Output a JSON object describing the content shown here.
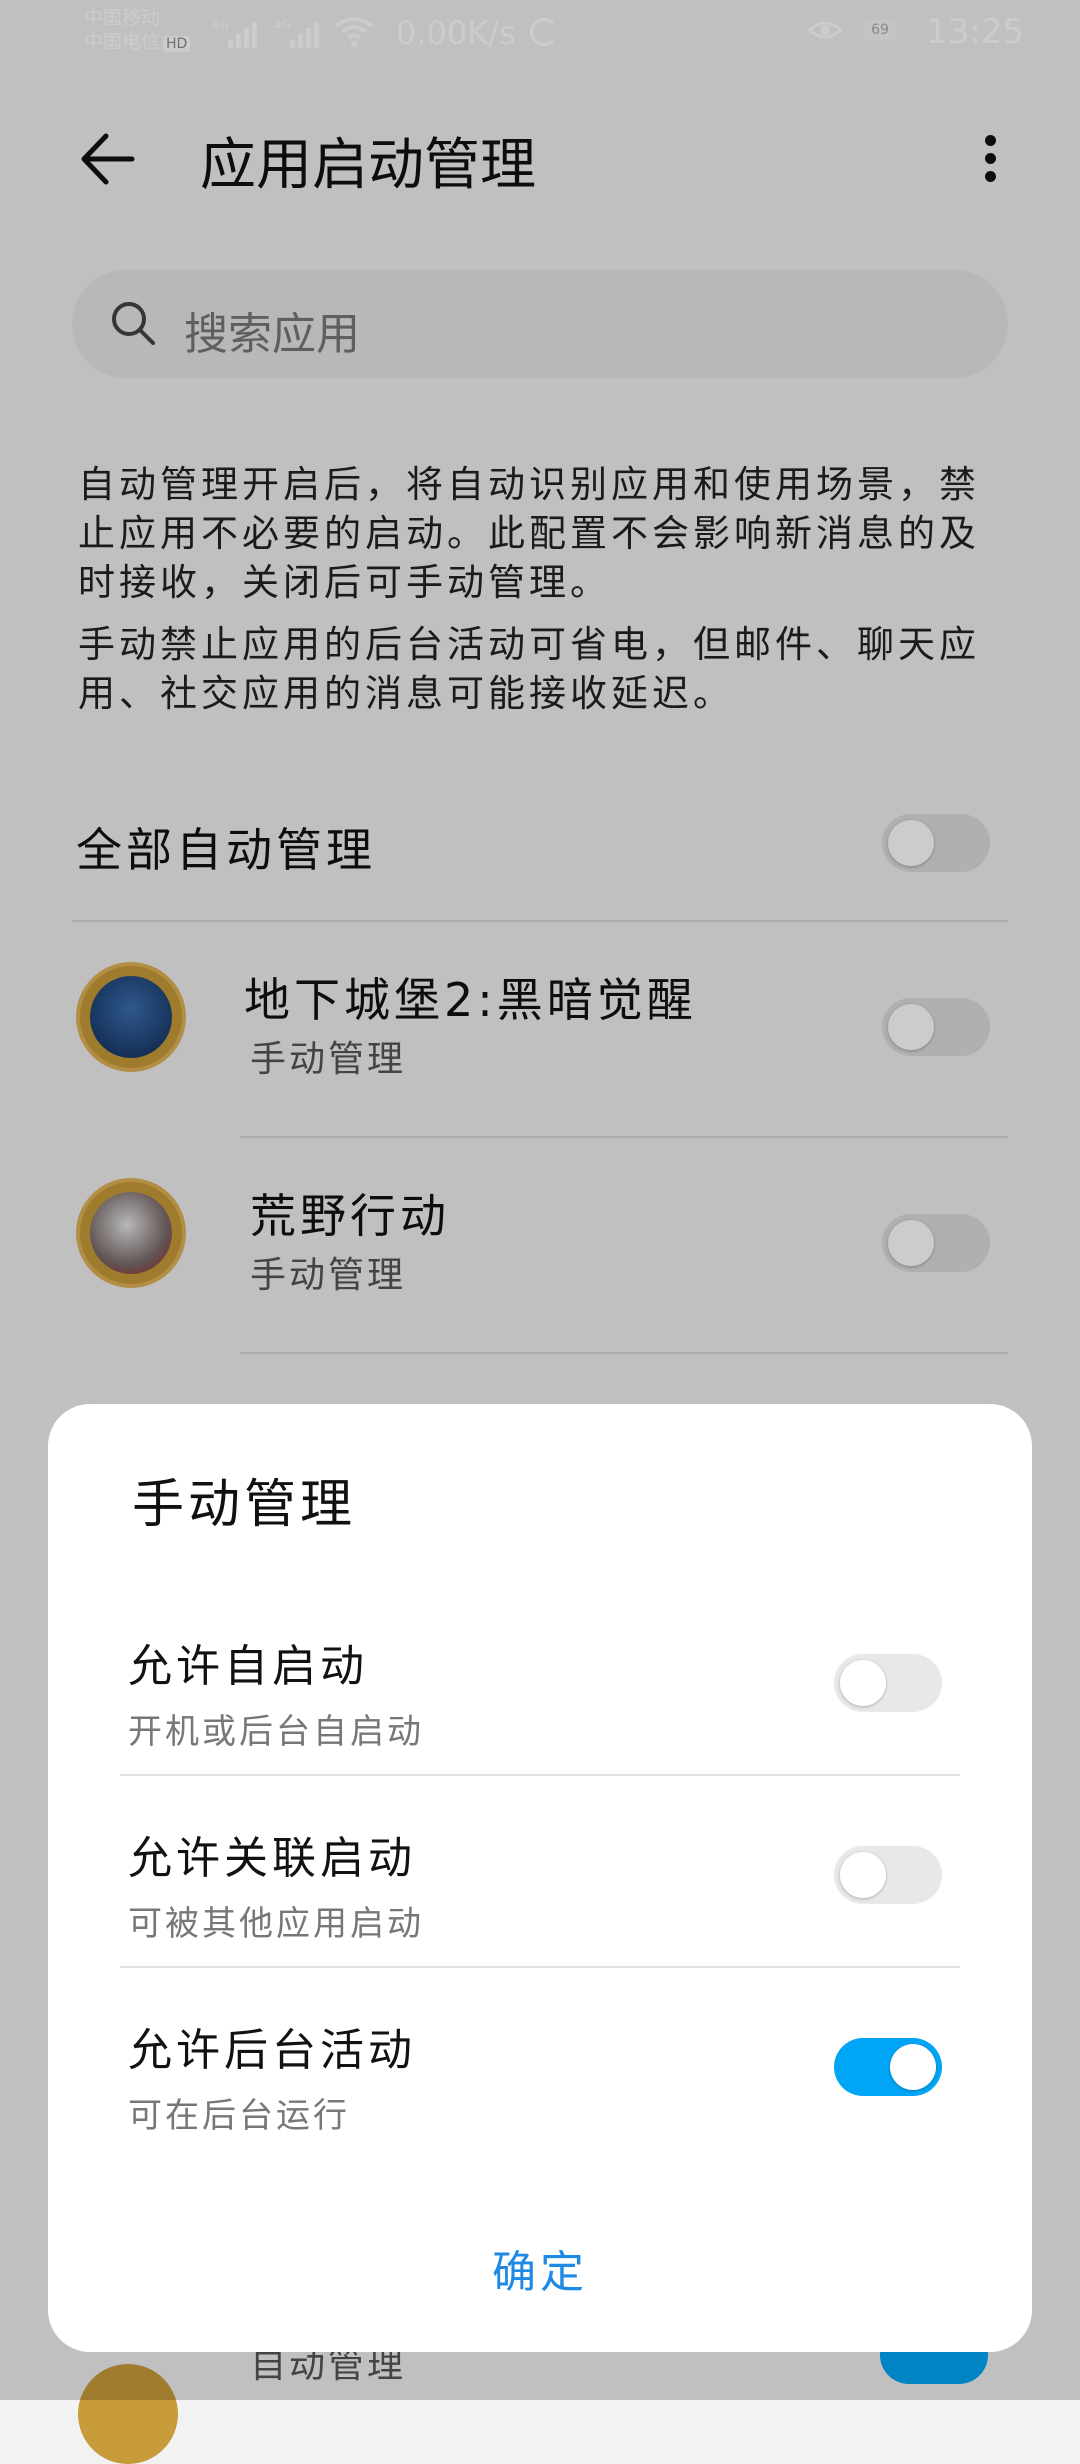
{
  "status_bar": {
    "carrier1": "中国移动",
    "carrier2": "中国电信",
    "hd": "HD",
    "sig1": "4G",
    "sig2": "4G",
    "speed": "0.00K/s",
    "battery": "69",
    "time": "13:25"
  },
  "header": {
    "title": "应用启动管理"
  },
  "search": {
    "placeholder": "搜索应用"
  },
  "description": {
    "para1": "自动管理开启后，将自动识别应用和使用场景，禁止应用不必要的启动。此配置不会影响新消息的及时接收，关闭后可手动管理。",
    "para2": "手动禁止应用的后台活动可省电，但邮件、聊天应用、社交应用的消息可能接收延迟。"
  },
  "all_auto": {
    "label": "全部自动管理",
    "on": false
  },
  "apps": [
    {
      "name": "地下城堡2:黑暗觉醒",
      "mode": "手动管理",
      "on": false
    },
    {
      "name": "荒野行动",
      "mode": "手动管理",
      "on": false
    }
  ],
  "peek": {
    "mode": "自动管理"
  },
  "dialog": {
    "title": "手动管理",
    "options": [
      {
        "label": "允许自启动",
        "sub": "开机或后台自启动",
        "on": false
      },
      {
        "label": "允许关联启动",
        "sub": "可被其他应用启动",
        "on": false
      },
      {
        "label": "允许后台活动",
        "sub": "可在后台运行",
        "on": true
      }
    ],
    "confirm": "确定"
  },
  "colors": {
    "accent": "#00a5f5",
    "confirm": "#1e8ae6"
  }
}
